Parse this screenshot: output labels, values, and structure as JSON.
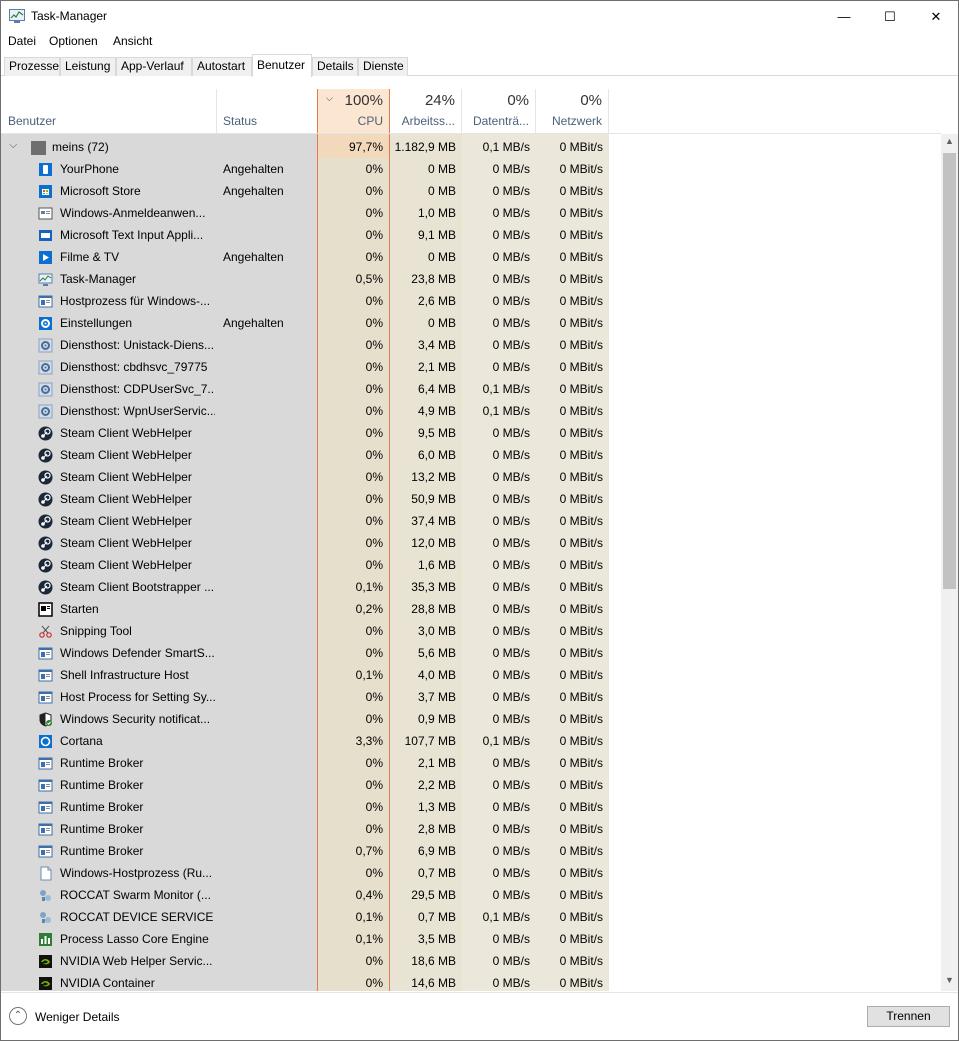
{
  "window": {
    "title": "Task-Manager",
    "controls": {
      "minimize": "—",
      "maximize": "☐",
      "close": "✕"
    }
  },
  "menu": [
    "Datei",
    "Optionen",
    "Ansicht"
  ],
  "tabs": [
    "Prozesse",
    "Leistung",
    "App-Verlauf",
    "Autostart",
    "Benutzer",
    "Details",
    "Dienste"
  ],
  "active_tab": "Benutzer",
  "columns": {
    "user": "Benutzer",
    "status": "Status",
    "cpu": {
      "pct": "100%",
      "name": "CPU"
    },
    "memory": {
      "pct": "24%",
      "name": "Arbeitss..."
    },
    "disk": {
      "pct": "0%",
      "name": "Datenträ..."
    },
    "network": {
      "pct": "0%",
      "name": "Netzwerk"
    }
  },
  "group": {
    "name": "meins (72)",
    "cpu": "97,7%",
    "memory": "1.182,9 MB",
    "disk": "0,1 MB/s",
    "network": "0 MBit/s"
  },
  "processes": [
    {
      "name": "YourPhone",
      "status": "Angehalten",
      "cpu": "0%",
      "memory": "0 MB",
      "disk": "0 MB/s",
      "network": "0 MBit/s",
      "icon": "phone-icon"
    },
    {
      "name": "Microsoft Store",
      "status": "Angehalten",
      "cpu": "0%",
      "memory": "0 MB",
      "disk": "0 MB/s",
      "network": "0 MBit/s",
      "icon": "store-icon"
    },
    {
      "name": "Windows-Anmeldeanwen...",
      "status": "",
      "cpu": "0%",
      "memory": "1,0 MB",
      "disk": "0 MB/s",
      "network": "0 MBit/s",
      "icon": "logon-icon"
    },
    {
      "name": "Microsoft Text Input Appli...",
      "status": "",
      "cpu": "0%",
      "memory": "9,1 MB",
      "disk": "0 MB/s",
      "network": "0 MBit/s",
      "icon": "keyboard-icon"
    },
    {
      "name": "Filme & TV",
      "status": "Angehalten",
      "cpu": "0%",
      "memory": "0 MB",
      "disk": "0 MB/s",
      "network": "0 MBit/s",
      "icon": "movies-icon"
    },
    {
      "name": "Task-Manager",
      "status": "",
      "cpu": "0,5%",
      "memory": "23,8 MB",
      "disk": "0 MB/s",
      "network": "0 MBit/s",
      "icon": "taskmanager-icon"
    },
    {
      "name": "Hostprozess für Windows-...",
      "status": "",
      "cpu": "0%",
      "memory": "2,6 MB",
      "disk": "0 MB/s",
      "network": "0 MBit/s",
      "icon": "window-process-icon"
    },
    {
      "name": "Einstellungen",
      "status": "Angehalten",
      "cpu": "0%",
      "memory": "0 MB",
      "disk": "0 MB/s",
      "network": "0 MBit/s",
      "icon": "settings-icon"
    },
    {
      "name": "Diensthost: Unistack-Diens...",
      "status": "",
      "cpu": "0%",
      "memory": "3,4 MB",
      "disk": "0 MB/s",
      "network": "0 MBit/s",
      "icon": "service-gear-icon"
    },
    {
      "name": "Diensthost: cbdhsvc_79775",
      "status": "",
      "cpu": "0%",
      "memory": "2,1 MB",
      "disk": "0 MB/s",
      "network": "0 MBit/s",
      "icon": "service-gear-icon"
    },
    {
      "name": "Diensthost: CDPUserSvc_7...",
      "status": "",
      "cpu": "0%",
      "memory": "6,4 MB",
      "disk": "0,1 MB/s",
      "network": "0 MBit/s",
      "icon": "service-gear-icon"
    },
    {
      "name": "Diensthost: WpnUserServic...",
      "status": "",
      "cpu": "0%",
      "memory": "4,9 MB",
      "disk": "0,1 MB/s",
      "network": "0 MBit/s",
      "icon": "service-gear-icon"
    },
    {
      "name": "Steam Client WebHelper",
      "status": "",
      "cpu": "0%",
      "memory": "9,5 MB",
      "disk": "0 MB/s",
      "network": "0 MBit/s",
      "icon": "steam-icon"
    },
    {
      "name": "Steam Client WebHelper",
      "status": "",
      "cpu": "0%",
      "memory": "6,0 MB",
      "disk": "0 MB/s",
      "network": "0 MBit/s",
      "icon": "steam-icon"
    },
    {
      "name": "Steam Client WebHelper",
      "status": "",
      "cpu": "0%",
      "memory": "13,2 MB",
      "disk": "0 MB/s",
      "network": "0 MBit/s",
      "icon": "steam-icon"
    },
    {
      "name": "Steam Client WebHelper",
      "status": "",
      "cpu": "0%",
      "memory": "50,9 MB",
      "disk": "0 MB/s",
      "network": "0 MBit/s",
      "icon": "steam-icon"
    },
    {
      "name": "Steam Client WebHelper",
      "status": "",
      "cpu": "0%",
      "memory": "37,4 MB",
      "disk": "0 MB/s",
      "network": "0 MBit/s",
      "icon": "steam-icon"
    },
    {
      "name": "Steam Client WebHelper",
      "status": "",
      "cpu": "0%",
      "memory": "12,0 MB",
      "disk": "0 MB/s",
      "network": "0 MBit/s",
      "icon": "steam-icon"
    },
    {
      "name": "Steam Client WebHelper",
      "status": "",
      "cpu": "0%",
      "memory": "1,6 MB",
      "disk": "0 MB/s",
      "network": "0 MBit/s",
      "icon": "steam-icon"
    },
    {
      "name": "Steam Client Bootstrapper ...",
      "status": "",
      "cpu": "0,1%",
      "memory": "35,3 MB",
      "disk": "0 MB/s",
      "network": "0 MBit/s",
      "icon": "steam-icon"
    },
    {
      "name": "Starten",
      "status": "",
      "cpu": "0,2%",
      "memory": "28,8 MB",
      "disk": "0 MB/s",
      "network": "0 MBit/s",
      "icon": "start-icon"
    },
    {
      "name": "Snipping Tool",
      "status": "",
      "cpu": "0%",
      "memory": "3,0 MB",
      "disk": "0 MB/s",
      "network": "0 MBit/s",
      "icon": "scissors-icon"
    },
    {
      "name": "Windows Defender SmartS...",
      "status": "",
      "cpu": "0%",
      "memory": "5,6 MB",
      "disk": "0 MB/s",
      "network": "0 MBit/s",
      "icon": "window-process-icon"
    },
    {
      "name": "Shell Infrastructure Host",
      "status": "",
      "cpu": "0,1%",
      "memory": "4,0 MB",
      "disk": "0 MB/s",
      "network": "0 MBit/s",
      "icon": "window-process-icon"
    },
    {
      "name": "Host Process for Setting Sy...",
      "status": "",
      "cpu": "0%",
      "memory": "3,7 MB",
      "disk": "0 MB/s",
      "network": "0 MBit/s",
      "icon": "window-process-icon"
    },
    {
      "name": "Windows Security notificat...",
      "status": "",
      "cpu": "0%",
      "memory": "0,9 MB",
      "disk": "0 MB/s",
      "network": "0 MBit/s",
      "icon": "shield-icon"
    },
    {
      "name": "Cortana",
      "status": "",
      "cpu": "3,3%",
      "memory": "107,7 MB",
      "disk": "0,1 MB/s",
      "network": "0 MBit/s",
      "icon": "cortana-icon"
    },
    {
      "name": "Runtime Broker",
      "status": "",
      "cpu": "0%",
      "memory": "2,1 MB",
      "disk": "0 MB/s",
      "network": "0 MBit/s",
      "icon": "window-process-icon"
    },
    {
      "name": "Runtime Broker",
      "status": "",
      "cpu": "0%",
      "memory": "2,2 MB",
      "disk": "0 MB/s",
      "network": "0 MBit/s",
      "icon": "window-process-icon"
    },
    {
      "name": "Runtime Broker",
      "status": "",
      "cpu": "0%",
      "memory": "1,3 MB",
      "disk": "0 MB/s",
      "network": "0 MBit/s",
      "icon": "window-process-icon"
    },
    {
      "name": "Runtime Broker",
      "status": "",
      "cpu": "0%",
      "memory": "2,8 MB",
      "disk": "0 MB/s",
      "network": "0 MBit/s",
      "icon": "window-process-icon"
    },
    {
      "name": "Runtime Broker",
      "status": "",
      "cpu": "0,7%",
      "memory": "6,9 MB",
      "disk": "0 MB/s",
      "network": "0 MBit/s",
      "icon": "window-process-icon"
    },
    {
      "name": "Windows-Hostprozess (Ru...",
      "status": "",
      "cpu": "0%",
      "memory": "0,7 MB",
      "disk": "0 MB/s",
      "network": "0 MBit/s",
      "icon": "document-icon"
    },
    {
      "name": "ROCCAT Swarm Monitor (...",
      "status": "",
      "cpu": "0,4%",
      "memory": "29,5 MB",
      "disk": "0 MB/s",
      "network": "0 MBit/s",
      "icon": "roccat-icon"
    },
    {
      "name": "ROCCAT DEVICE SERVICE (...",
      "status": "",
      "cpu": "0,1%",
      "memory": "0,7 MB",
      "disk": "0,1 MB/s",
      "network": "0 MBit/s",
      "icon": "roccat-icon"
    },
    {
      "name": "Process Lasso Core Engine",
      "status": "",
      "cpu": "0,1%",
      "memory": "3,5 MB",
      "disk": "0 MB/s",
      "network": "0 MBit/s",
      "icon": "process-lasso-icon"
    },
    {
      "name": "NVIDIA Web Helper Servic...",
      "status": "",
      "cpu": "0%",
      "memory": "18,6 MB",
      "disk": "0 MB/s",
      "network": "0 MBit/s",
      "icon": "nvidia-icon"
    },
    {
      "name": "NVIDIA Container",
      "status": "",
      "cpu": "0%",
      "memory": "14,6 MB",
      "disk": "0 MB/s",
      "network": "0 MBit/s",
      "icon": "nvidia-icon"
    }
  ],
  "footer": {
    "fewer_details": "Weniger Details",
    "disconnect": "Trennen"
  },
  "colors": {
    "cpu_column": "#e6dfcc",
    "cpu_header": "#f3d9bb",
    "cpu_border": "#e07a55",
    "user_column": "#d9d9d9"
  }
}
